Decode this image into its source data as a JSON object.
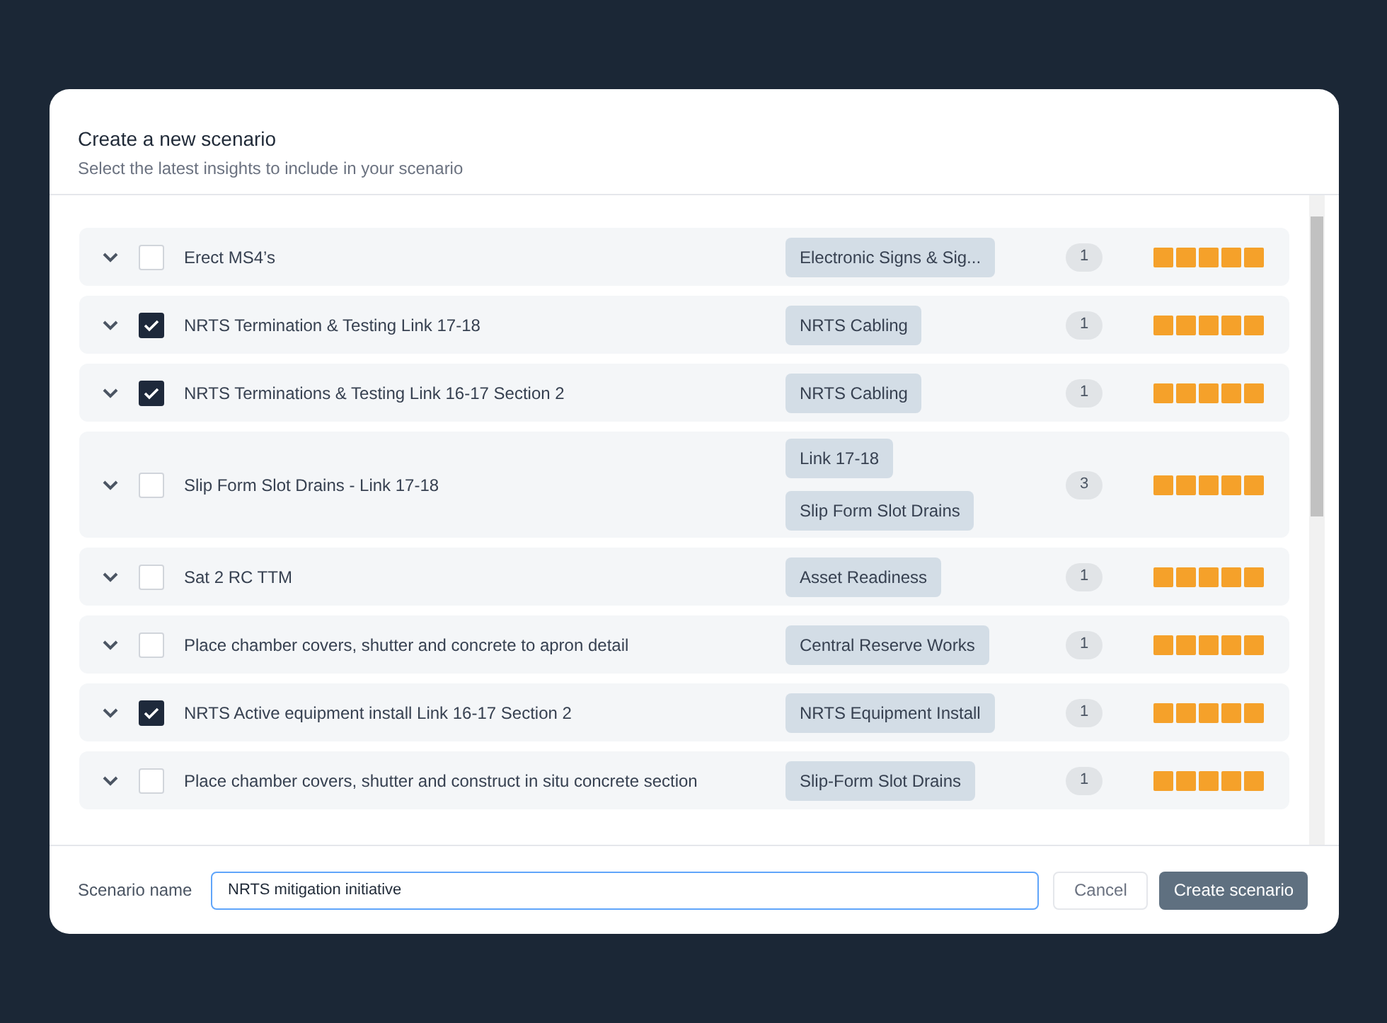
{
  "dialog": {
    "title": "Create a new scenario",
    "subtitle": "Select the latest insights to include in your scenario"
  },
  "insights": [
    {
      "label": "Erect MS4’s",
      "checked": false,
      "tags": [
        "Electronic Signs & Sig..."
      ],
      "count": "1",
      "stars": 5
    },
    {
      "label": "NRTS Termination & Testing Link 17-18",
      "checked": true,
      "tags": [
        "NRTS Cabling"
      ],
      "count": "1",
      "stars": 5
    },
    {
      "label": "NRTS Terminations & Testing Link 16-17 Section 2",
      "checked": true,
      "tags": [
        "NRTS Cabling"
      ],
      "count": "1",
      "stars": 5
    },
    {
      "label": "Slip Form Slot Drains - Link 17-18",
      "checked": false,
      "tags": [
        "Link 17-18",
        "Slip Form Slot Drains"
      ],
      "count": "3",
      "stars": 5
    },
    {
      "label": "Sat 2 RC TTM",
      "checked": false,
      "tags": [
        "Asset Readiness"
      ],
      "count": "1",
      "stars": 5
    },
    {
      "label": "Place chamber covers, shutter and concrete to apron detail",
      "checked": false,
      "tags": [
        "Central Reserve Works"
      ],
      "count": "1",
      "stars": 5
    },
    {
      "label": "NRTS Active equipment install Link 16-17 Section 2",
      "checked": true,
      "tags": [
        "NRTS Equipment Install"
      ],
      "count": "1",
      "stars": 5
    },
    {
      "label": "Place chamber covers, shutter and construct in situ concrete section",
      "checked": false,
      "tags": [
        "Slip-Form Slot Drains"
      ],
      "count": "1",
      "stars": 5
    }
  ],
  "footer": {
    "name_label": "Scenario name",
    "name_value": "NRTS mitigation initiative",
    "cancel": "Cancel",
    "create": "Create scenario"
  }
}
